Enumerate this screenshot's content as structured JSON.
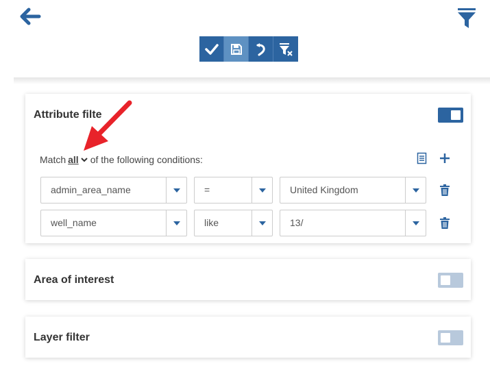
{
  "colors": {
    "primary": "#2c64a0",
    "primary_light": "#5e91c2",
    "toggle_off": "#b8c9dc",
    "arrow_annotation": "#e8232a"
  },
  "header": {
    "back_icon": "arrow-left-icon",
    "filter_icon": "funnel-icon"
  },
  "toolbar": {
    "buttons": [
      {
        "icon": "checkmark-icon",
        "action": "apply"
      },
      {
        "icon": "save-icon",
        "action": "save"
      },
      {
        "icon": "undo-icon",
        "action": "undo"
      },
      {
        "icon": "clear-filter-icon",
        "action": "clear"
      }
    ]
  },
  "attribute_filter": {
    "title": "Attribute filte",
    "enabled": true,
    "match_prefix": "Match",
    "match_mode": "all",
    "match_suffix": "of the following conditions:",
    "conditions": [
      {
        "field": "admin_area_name",
        "operator": "=",
        "value": "United Kingdom"
      },
      {
        "field": "well_name",
        "operator": "like",
        "value": "13/"
      }
    ]
  },
  "area_of_interest": {
    "title": "Area of interest",
    "enabled": false
  },
  "layer_filter": {
    "title": "Layer filter",
    "enabled": false
  }
}
